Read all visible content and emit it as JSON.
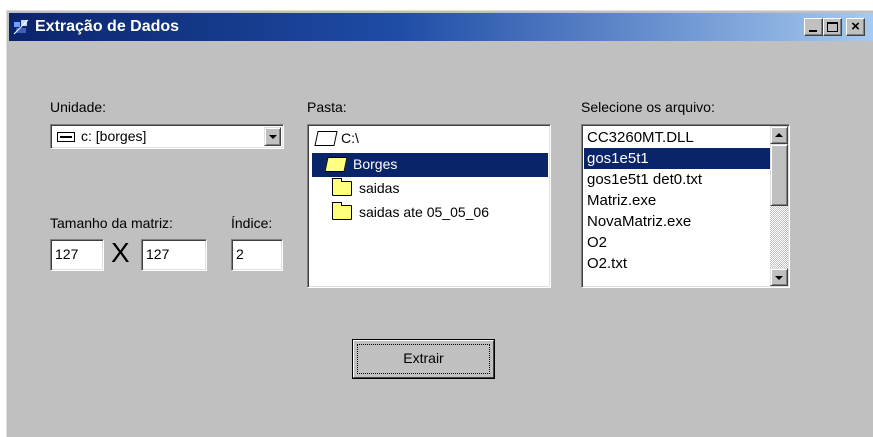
{
  "window": {
    "title": "Extração de Dados",
    "icon": "app-icon"
  },
  "caption_buttons": {
    "minimize": "minimize-icon",
    "maximize": "maximize-icon",
    "close": "×"
  },
  "unidade": {
    "label": "Unidade:",
    "value": "c: [borges]"
  },
  "matriz": {
    "label": "Tamanho da matriz:",
    "rows": "127",
    "times": "X",
    "cols": "127"
  },
  "indice": {
    "label": "Índice:",
    "value": "2"
  },
  "pasta": {
    "label": "Pasta:",
    "items": [
      "C:\\",
      "Borges",
      "saidas",
      "saidas ate 05_05_06"
    ],
    "selected_index": 1
  },
  "arquivos": {
    "label": "Selecione os arquivo:",
    "items": [
      "CC3260MT.DLL",
      "gos1e5t1",
      "gos1e5t1 det0.txt",
      "Matriz.exe",
      "NovaMatriz.exe",
      "O2",
      "O2.txt"
    ],
    "selected_index": 1
  },
  "extrair_button": {
    "label": "Extrair"
  },
  "colors": {
    "title_start": "#0a246a",
    "title_end": "#a6caf0",
    "face": "#c0c0c0",
    "selection": "#0a246a"
  }
}
